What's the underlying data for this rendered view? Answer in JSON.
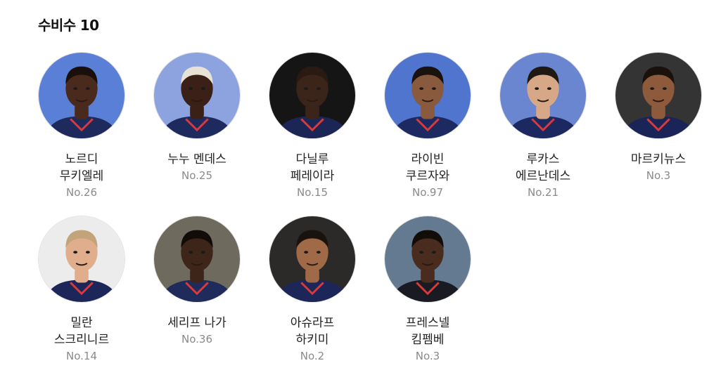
{
  "section": {
    "title": "수비수",
    "count": "10"
  },
  "players": [
    {
      "name": "노르디\n무키엘레",
      "number": "No.26",
      "bg": "#5a7fd6",
      "skin": "#4a2a1c",
      "hair": "#1a0f0a",
      "shirt": "#1f2a5c"
    },
    {
      "name": "누누 멘데스",
      "number": "No.25",
      "bg": "#8da3df",
      "skin": "#3a2016",
      "hair": "#e8e2d6",
      "shirt": "#1e2a5e"
    },
    {
      "name": "다닐루\n페레이라",
      "number": "No.15",
      "bg": "#151515",
      "skin": "#3b2419",
      "hair": "#2a1a12",
      "shirt": "#1c2656"
    },
    {
      "name": "라이빈\n쿠르자와",
      "number": "No.97",
      "bg": "#4f75cf",
      "skin": "#8a5a3e",
      "hair": "#1b120d",
      "shirt": "#1d2a62"
    },
    {
      "name": "루카스\n에르난데스",
      "number": "No.21",
      "bg": "#6b86d0",
      "skin": "#d7a888",
      "hair": "#1f1813",
      "shirt": "#1c2860"
    },
    {
      "name": "마르키뉴스",
      "number": "No.3",
      "bg": "#343434",
      "skin": "#8d5a3b",
      "hair": "#1a110c",
      "shirt": "#1b2456"
    },
    {
      "name": "밀란\n스크리니르",
      "number": "No.14",
      "bg": "#ececec",
      "skin": "#e0ae8d",
      "hair": "#c2a47a",
      "shirt": "#1d2658"
    },
    {
      "name": "세리프 나가",
      "number": "No.36",
      "bg": "#6e6a5e",
      "skin": "#3e2519",
      "hair": "#120c09",
      "shirt": "#1f2b5a"
    },
    {
      "name": "아슈라프\n하키미",
      "number": "No.2",
      "bg": "#2b2a29",
      "skin": "#a06a48",
      "hair": "#1a120c",
      "shirt": "#1c2658"
    },
    {
      "name": "프레스넬\n킴펨베",
      "number": "No.3",
      "bg": "#647a90",
      "skin": "#4a2c1f",
      "hair": "#130d0a",
      "shirt": "#1a1a22"
    }
  ]
}
